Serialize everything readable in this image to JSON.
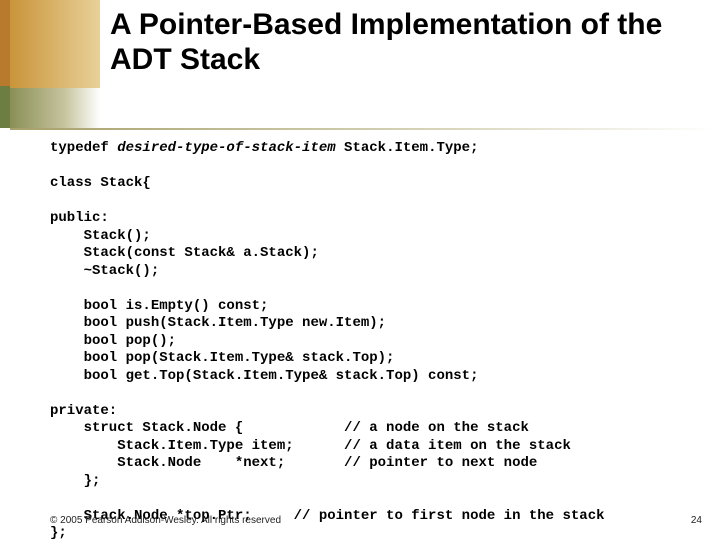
{
  "title": "A Pointer-Based Implementation of the ADT Stack",
  "code": {
    "l1a": "typedef ",
    "l1b": "desired-type-of-stack-item",
    "l1c": " Stack.Item.Type;",
    "l2": "class Stack{",
    "l3": "public:",
    "l4": "    Stack();",
    "l5": "    Stack(const Stack& a.Stack);",
    "l6": "    ~Stack();",
    "l7": "    bool is.Empty() const;",
    "l8": "    bool push(Stack.Item.Type new.Item);",
    "l9": "    bool pop();",
    "l10": "    bool pop(Stack.Item.Type& stack.Top);",
    "l11": "    bool get.Top(Stack.Item.Type& stack.Top) const;",
    "l12": "private:",
    "l13": "    struct Stack.Node {            // a node on the stack",
    "l14": "        Stack.Item.Type item;      // a data item on the stack",
    "l15": "        Stack.Node    *next;       // pointer to next node",
    "l16": "    };",
    "l17": "    Stack.Node *top.Ptr;     // pointer to first node in the stack",
    "l18": "};"
  },
  "footer": {
    "copyright": "© 2005 Pearson Addison-Wesley. All rights reserved",
    "page": "24"
  }
}
